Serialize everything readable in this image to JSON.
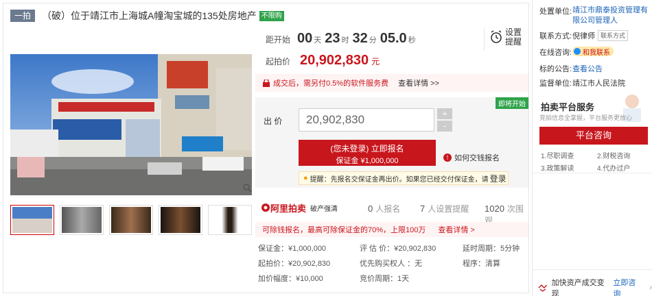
{
  "header": {
    "tag": "一拍",
    "title": "（破）位于靖江市上海城A幢淘宝城的135处房地产",
    "badge": "不限购"
  },
  "countdown": {
    "label": "距开始",
    "days": "00",
    "days_unit": "天",
    "hours": "23",
    "hours_unit": "时",
    "minutes": "32",
    "minutes_unit": "分",
    "seconds": "05.0",
    "seconds_unit": "秒",
    "reminder": "设置提醒"
  },
  "price": {
    "label": "起拍价",
    "value": "20,902,830",
    "unit": "元"
  },
  "fee": {
    "text": "成交后，需另付0.5%的软件服务费",
    "link": "查看详情 >>"
  },
  "bid": {
    "soon_tag": "即将开始",
    "label": "出 价",
    "input_value": "20,902,830",
    "plus": "+",
    "minus": "-",
    "signup_line1": "(您未登录) 立即报名",
    "signup_line2": "保证金 ¥1,000,000",
    "howto": "如何交钱报名",
    "tip_prefix": "提醒：先报名交保证金再出价。如果您已经交付保证金，请",
    "tip_login": "登录"
  },
  "stats": {
    "logo": "阿里拍卖",
    "logo_sub": "破产强清",
    "signups_num": "0",
    "signups_label": "人报名",
    "reminders_num": "7",
    "reminders_label": "人设置提醒",
    "views_num": "1020",
    "views_label": "次围观"
  },
  "policy": {
    "text": "可除钱报名，最高可除保证金的70%，上限100万",
    "link": "查看详情 >"
  },
  "details": {
    "deposit": "保证金：¥1,000,000",
    "appraisal": "评 估 价：¥20,902,830",
    "delay": "延时周期：5分钟",
    "start_price": "起拍价：¥20,902,830",
    "priority": "优先购买权人 ：无",
    "procedure": "程序：清算",
    "increment": "加价幅度：¥10,000",
    "period": "竞价周期：1天"
  },
  "right": {
    "disposer_label": "处置单位:",
    "disposer": "靖江市鼎泰投资管理有限公司管理人",
    "contact_label": "联系方式:",
    "contact_name": "倪律师",
    "contact_tag": "联系方式",
    "consult_label": "在线咨询:",
    "consult_btn": "和我联系",
    "notice_label": "标的公告:",
    "notice_link": "查看公告",
    "court_label": "监督单位:",
    "court": "靖江市人民法院",
    "service_title": "拍卖平台服务",
    "service_sub": "竞拍信息全掌握，平台服务更放心",
    "service_btn": "平台咨询",
    "svc1": "1.尽职调查",
    "svc2": "2.财税咨询",
    "svc3": "3.政策解读",
    "svc4": "4.代办过户",
    "bottom_text": "加快资产成交变现",
    "bottom_link": "立即咨询"
  },
  "colors": {
    "accent": "#c8161d",
    "green": "#2fa34a",
    "link": "#1a63b8"
  }
}
